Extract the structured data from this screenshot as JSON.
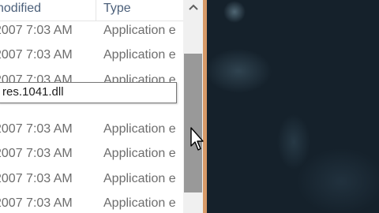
{
  "columns": {
    "modified": "nodified",
    "type": "Type"
  },
  "rows": [
    {
      "date": "2007 7:03 AM",
      "type": "Application e"
    },
    {
      "date": "2007 7:03 AM",
      "type": "Application e"
    },
    {
      "date": "2007 7:03 AM",
      "type": "Application e"
    },
    {
      "date": "2007 7:03 AM",
      "type": "Application e"
    },
    {
      "date": "2007 7:03 AM",
      "type": "Application e"
    },
    {
      "date": "2007 7:03 AM",
      "type": "Application e"
    },
    {
      "date": "2007 7:03 AM",
      "type": "Application e"
    },
    {
      "date": "2007 7:03 AM",
      "type": "Application e"
    }
  ],
  "tooltip": {
    "text": "res.1041.dll"
  },
  "icons": {
    "scroll_up": "chevron-up-icon",
    "cursor": "mouse-pointer-icon"
  }
}
